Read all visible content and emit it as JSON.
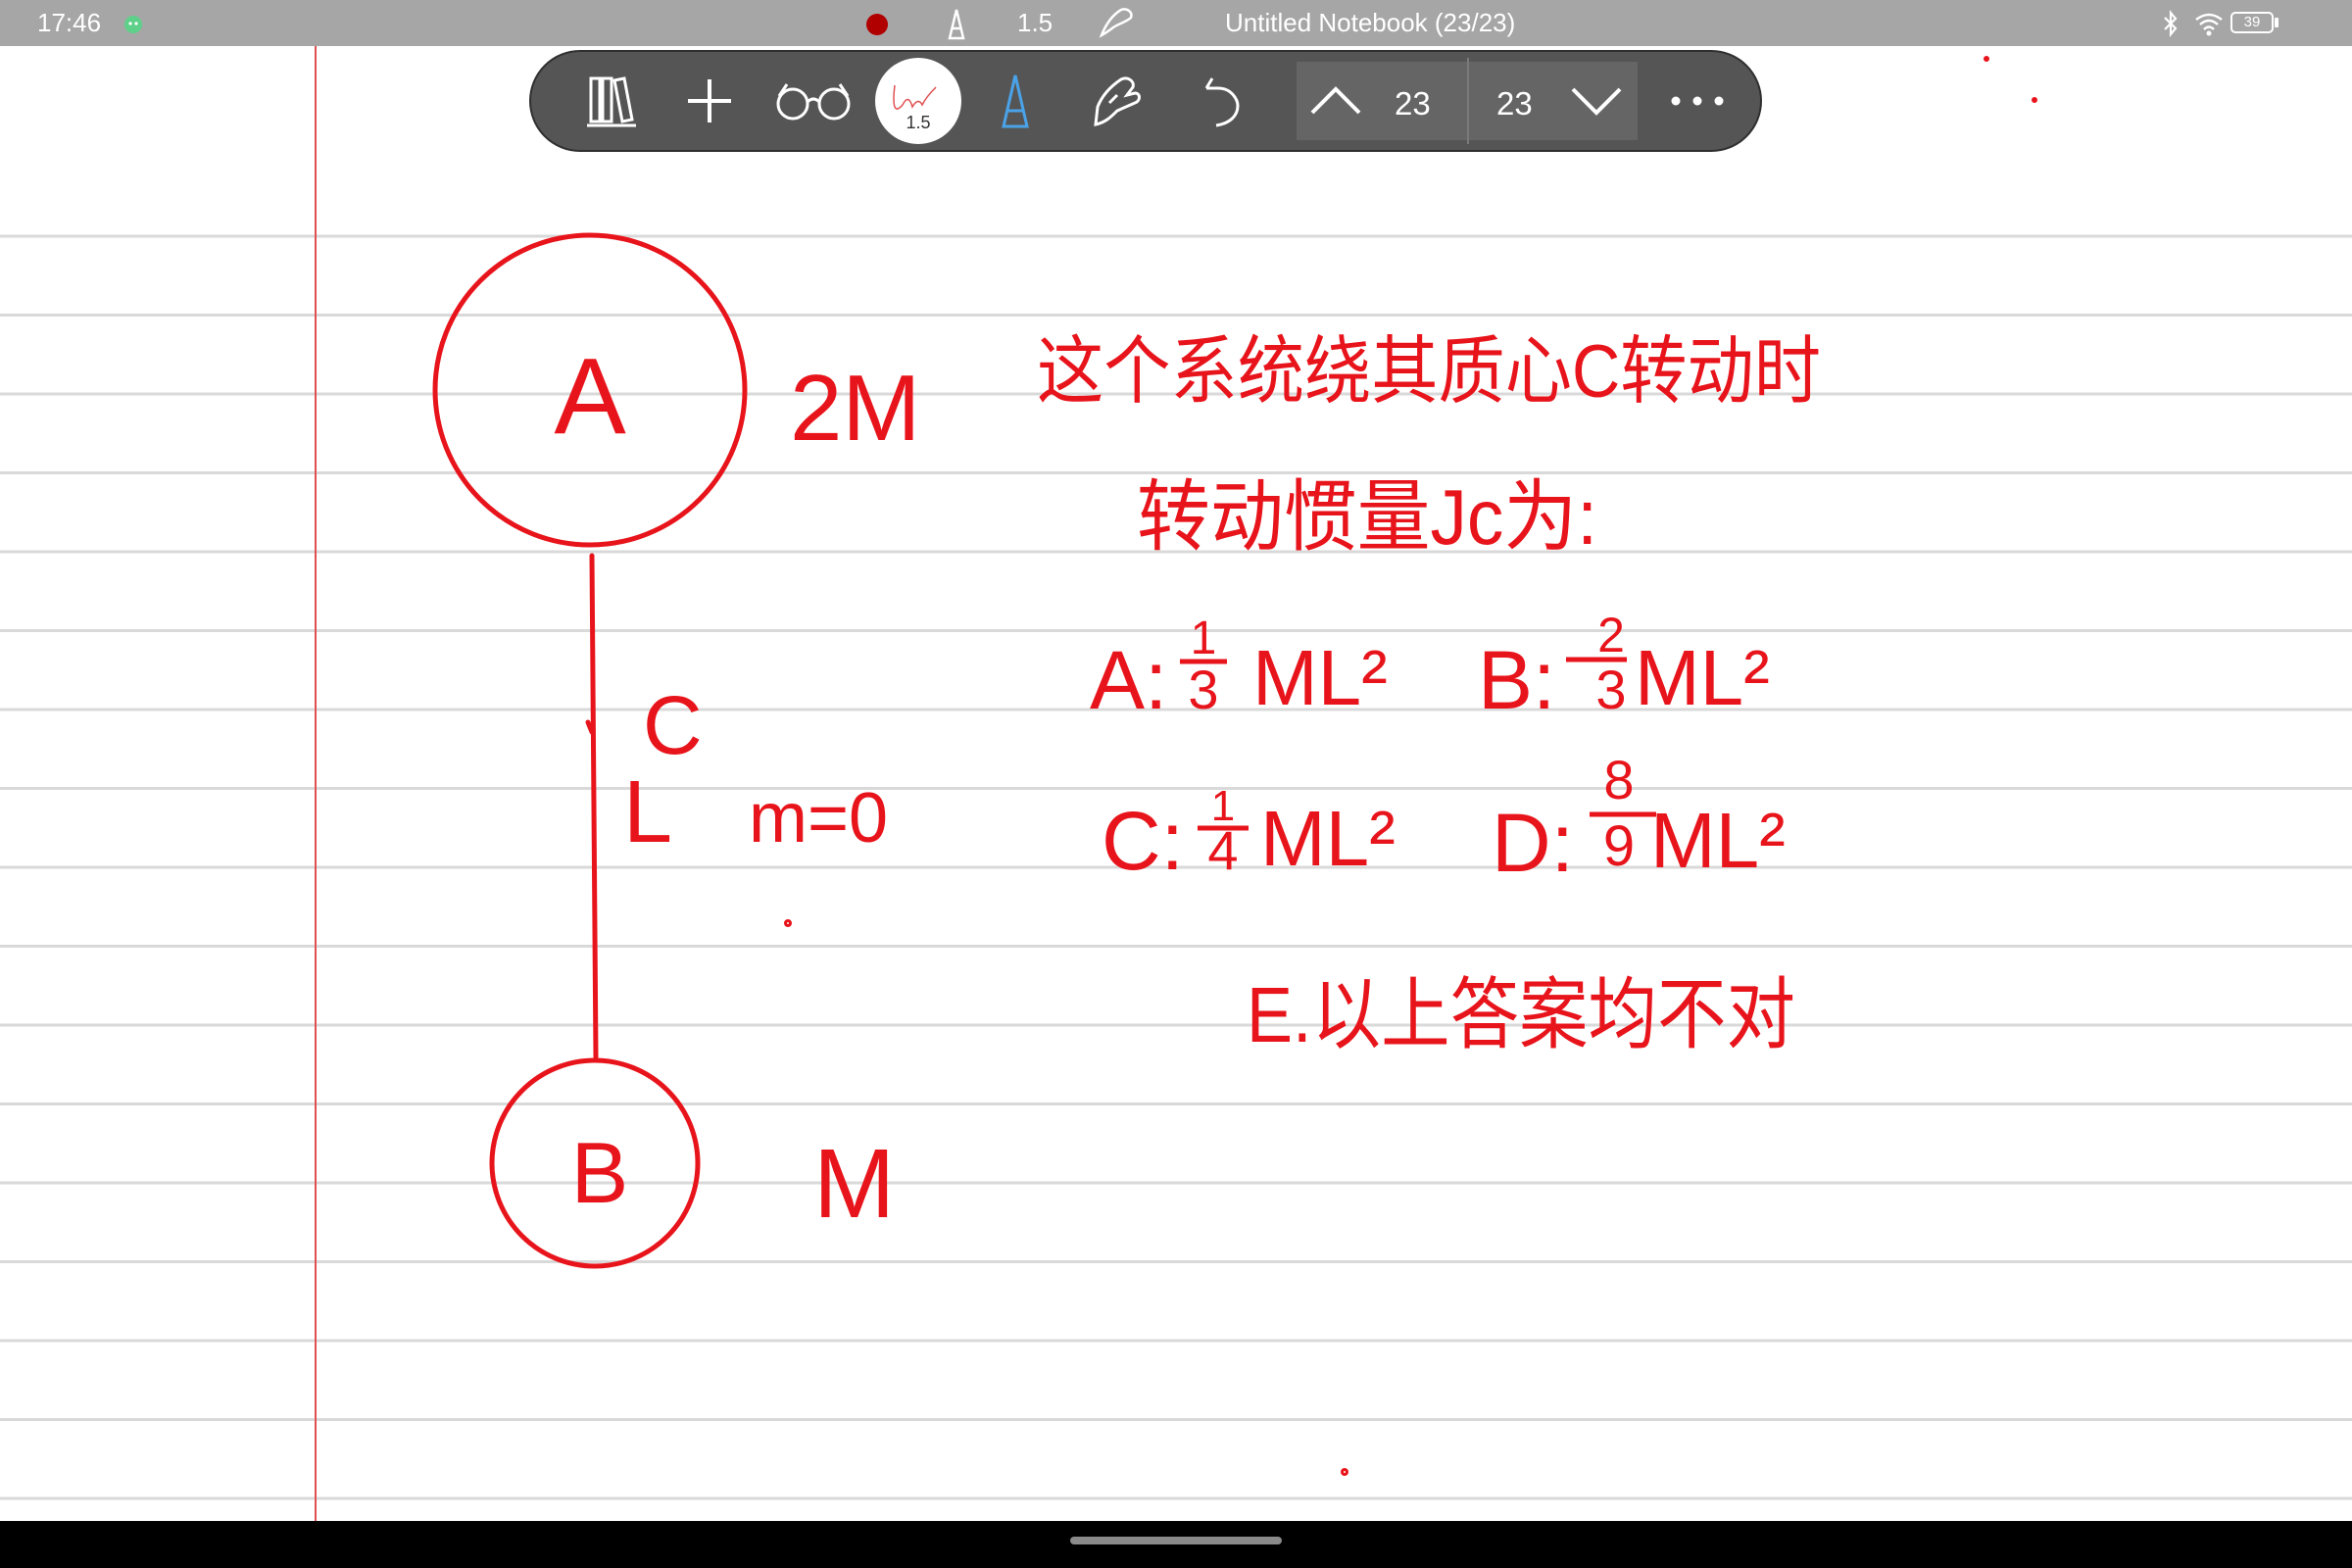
{
  "status_bar": {
    "time": "17:46",
    "pen_size": "1.5",
    "notebook_title": "Untitled Notebook (23/23)",
    "battery": "39"
  },
  "toolbar": {
    "pen_size_label": "1.5",
    "current_page": "23",
    "total_pages": "23"
  },
  "colors": {
    "ink": "#e8141b",
    "paper_line": "#d9d9d9",
    "margin_line": "#e05050",
    "toolbar_bg": "#555555",
    "status_bar_bg": "#a6a6a6",
    "pen_icon_blue": "#4aa3e8"
  },
  "icons": [
    "library-icon",
    "add-icon",
    "reading-mode-icon",
    "pen-preset-icon",
    "pencil-tool-icon",
    "hand-tool-icon",
    "undo-icon",
    "chevron-up-icon",
    "chevron-down-icon",
    "more-icon",
    "bluetooth-icon",
    "wifi-icon",
    "battery-icon"
  ],
  "note": {
    "label_A": "A",
    "mass_A": "2M",
    "label_C": "C",
    "label_L": "L",
    "rod_mass": "m=0",
    "label_B": "B",
    "mass_B": "M",
    "question_line1": "这个系统绕其质心C转动时",
    "question_line2": "转动惯量Jc为:",
    "option_A_label": "A:",
    "option_A_num": "1",
    "option_A_den": "3",
    "option_A_tail": "ML²",
    "option_B_label": "B:",
    "option_B_num": "2",
    "option_B_den": "3",
    "option_B_tail": "ML²",
    "option_C_label": "C:",
    "option_C_num": "1",
    "option_C_den": "4",
    "option_C_tail": "ML²",
    "option_D_label": "D:",
    "option_D_num": "8",
    "option_D_den": "9",
    "option_D_tail": "ML²",
    "option_E": "E.以上答案均不对"
  }
}
